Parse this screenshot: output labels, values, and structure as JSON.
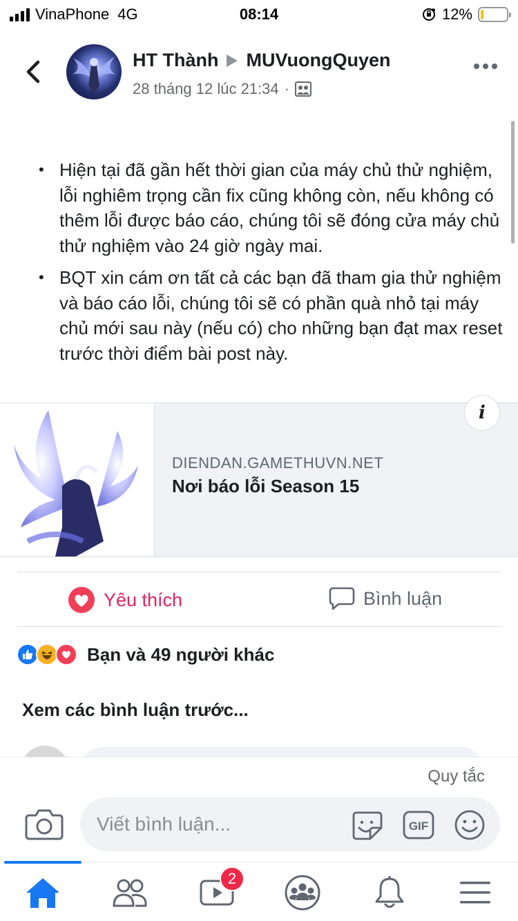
{
  "status_bar": {
    "carrier": "VinaPhone",
    "network": "4G",
    "time": "08:14",
    "battery_percent": "12%",
    "battery_level": 0.12,
    "battery_color": "#f6c400"
  },
  "header": {
    "author": "HT Thành",
    "group": "MUVuongQuyen",
    "timestamp": "28 tháng 12 lúc 21:34",
    "separator": "·",
    "audience_icon": "group-icon"
  },
  "post": {
    "bullets": [
      "Hiện tại đã gần hết thời gian của máy chủ thử nghiệm, lỗi nghiêm trọng cần fix cũng không còn, nếu không có thêm lỗi được báo cáo, chúng tôi sẽ đóng cửa máy chủ thử nghiệm vào 24 giờ ngày mai.",
      "BQT xin cám ơn tất cả các bạn đã tham gia thử nghiệm và báo cáo lỗi, chúng tôi sẽ có phần quà nhỏ tại máy chủ mới sau này (nếu có) cho những bạn đạt max reset trước thời điểm bài post này."
    ]
  },
  "link_preview": {
    "domain": "DIENDAN.GAMETHUVN.NET",
    "title": "Nơi báo lỗi Season 15",
    "info_label": "i"
  },
  "actions": {
    "like_label": "Yêu thích",
    "comment_label": "Bình luận",
    "like_color": "#e0245e"
  },
  "reactions": {
    "summary": "Bạn và 49 người khác",
    "icons": [
      "like-icon",
      "haha-icon",
      "love-icon"
    ]
  },
  "comments": {
    "view_previous": "Xem các bình luận trước..."
  },
  "composer": {
    "rules": "Quy tắc",
    "placeholder": "Viết bình luận..."
  },
  "tabbar": {
    "active_color": "#1877f2",
    "video_badge": "2",
    "tabs": [
      "home-icon",
      "friends-icon",
      "watch-icon",
      "groups-icon",
      "notifications-icon",
      "menu-icon"
    ]
  }
}
